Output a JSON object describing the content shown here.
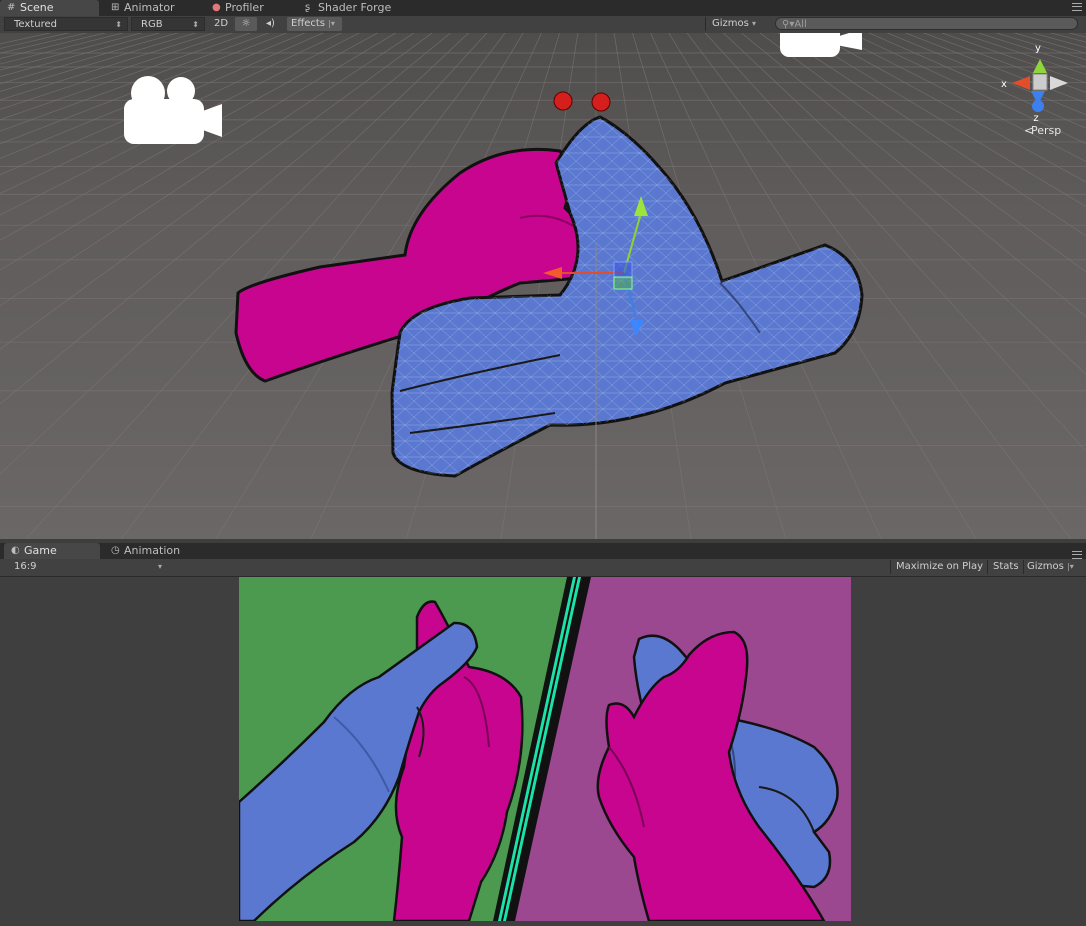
{
  "scene_tabs": [
    {
      "label": "Scene",
      "icon": "grid-icon"
    },
    {
      "label": "Animator",
      "icon": "animator-icon"
    },
    {
      "label": "Profiler",
      "icon": "profiler-icon"
    },
    {
      "label": "Shader Forge",
      "icon": "shader-forge-icon"
    }
  ],
  "scene_toolbar": {
    "render_mode": "Textured",
    "color_mode": "RGB",
    "mode_2d": "2D",
    "sun_icon": "sun-icon",
    "audio_icon": "speaker-icon",
    "effects": "Effects",
    "gizmos": "Gizmos",
    "search_placeholder": "All"
  },
  "gizmo": {
    "y": "y",
    "x": "x",
    "z": "z",
    "projection": "Persp"
  },
  "bottom_tabs": [
    {
      "label": "Game",
      "icon": "game-icon"
    },
    {
      "label": "Animation",
      "icon": "clock-icon"
    }
  ],
  "game_toolbar": {
    "aspect": "16:9",
    "maximize": "Maximize on Play",
    "stats": "Stats",
    "gizmos": "Gizmos"
  },
  "colors": {
    "tab_bar": "#2b2b2b",
    "toolbar": "#414141",
    "scene_bg": "#666261",
    "hand_magenta": "#c8058f",
    "hand_blue": "#5a78d0",
    "game_green": "#4c9a4f",
    "game_purple": "#9b4890",
    "mirror_cyan": "#1be2a9"
  }
}
